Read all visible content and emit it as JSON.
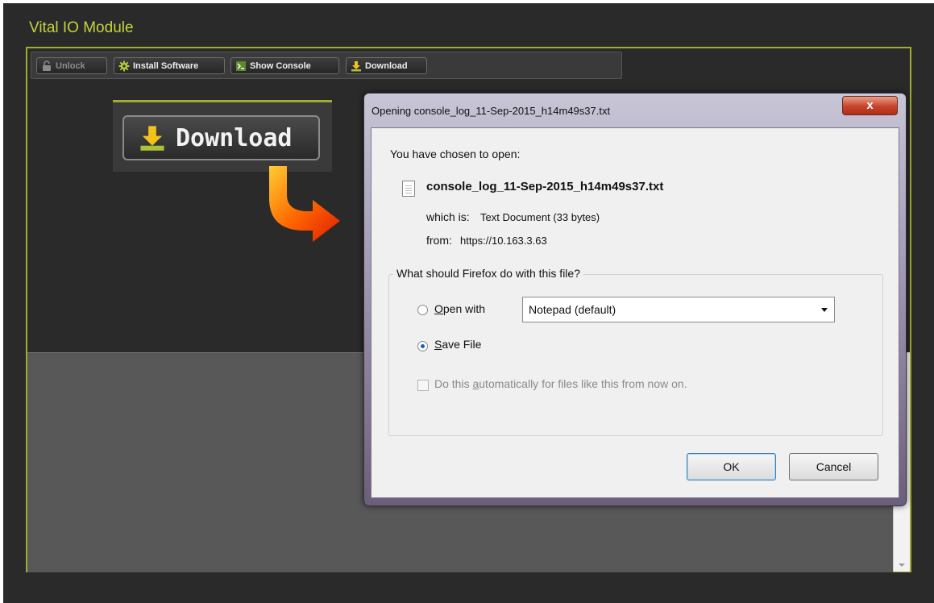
{
  "app": {
    "title": "Vital IO Module",
    "accent_color": "#a1ab2e",
    "title_color": "#c6d43b"
  },
  "toolbar": {
    "buttons": [
      {
        "label": "Unlock",
        "icon": "lock-icon",
        "enabled": false
      },
      {
        "label": "Install Software",
        "icon": "gear-icon",
        "enabled": true
      },
      {
        "label": "Show Console",
        "icon": "console-icon",
        "enabled": true
      },
      {
        "label": "Download",
        "icon": "download-icon",
        "enabled": true
      }
    ]
  },
  "callout": {
    "download_label": "Download",
    "icon": "download-icon",
    "arrow": "curved-arrow-icon"
  },
  "dialog": {
    "title": "Opening console_log_11-Sep-2015_h14m49s37.txt",
    "close_label": "x",
    "chosen_text": "You have chosen to open:",
    "filename": "console_log_11-Sep-2015_h14m49s37.txt",
    "which_is_label": "which is:",
    "which_is_value": "Text Document (33 bytes)",
    "from_label": "from:",
    "from_value": "https://10.163.3.63",
    "question": "What should Firefox do with this file?",
    "open_with_label_pre": "",
    "open_with_key": "O",
    "open_with_label_post": "pen with",
    "open_with_selected": "Notepad (default)",
    "save_file_key": "S",
    "save_file_label_post": "ave File",
    "selected_option": "save_file",
    "auto_pre": "Do this ",
    "auto_key": "a",
    "auto_post": "utomatically for files like this from now on.",
    "auto_checked": false,
    "ok_label": "OK",
    "cancel_label": "Cancel"
  }
}
